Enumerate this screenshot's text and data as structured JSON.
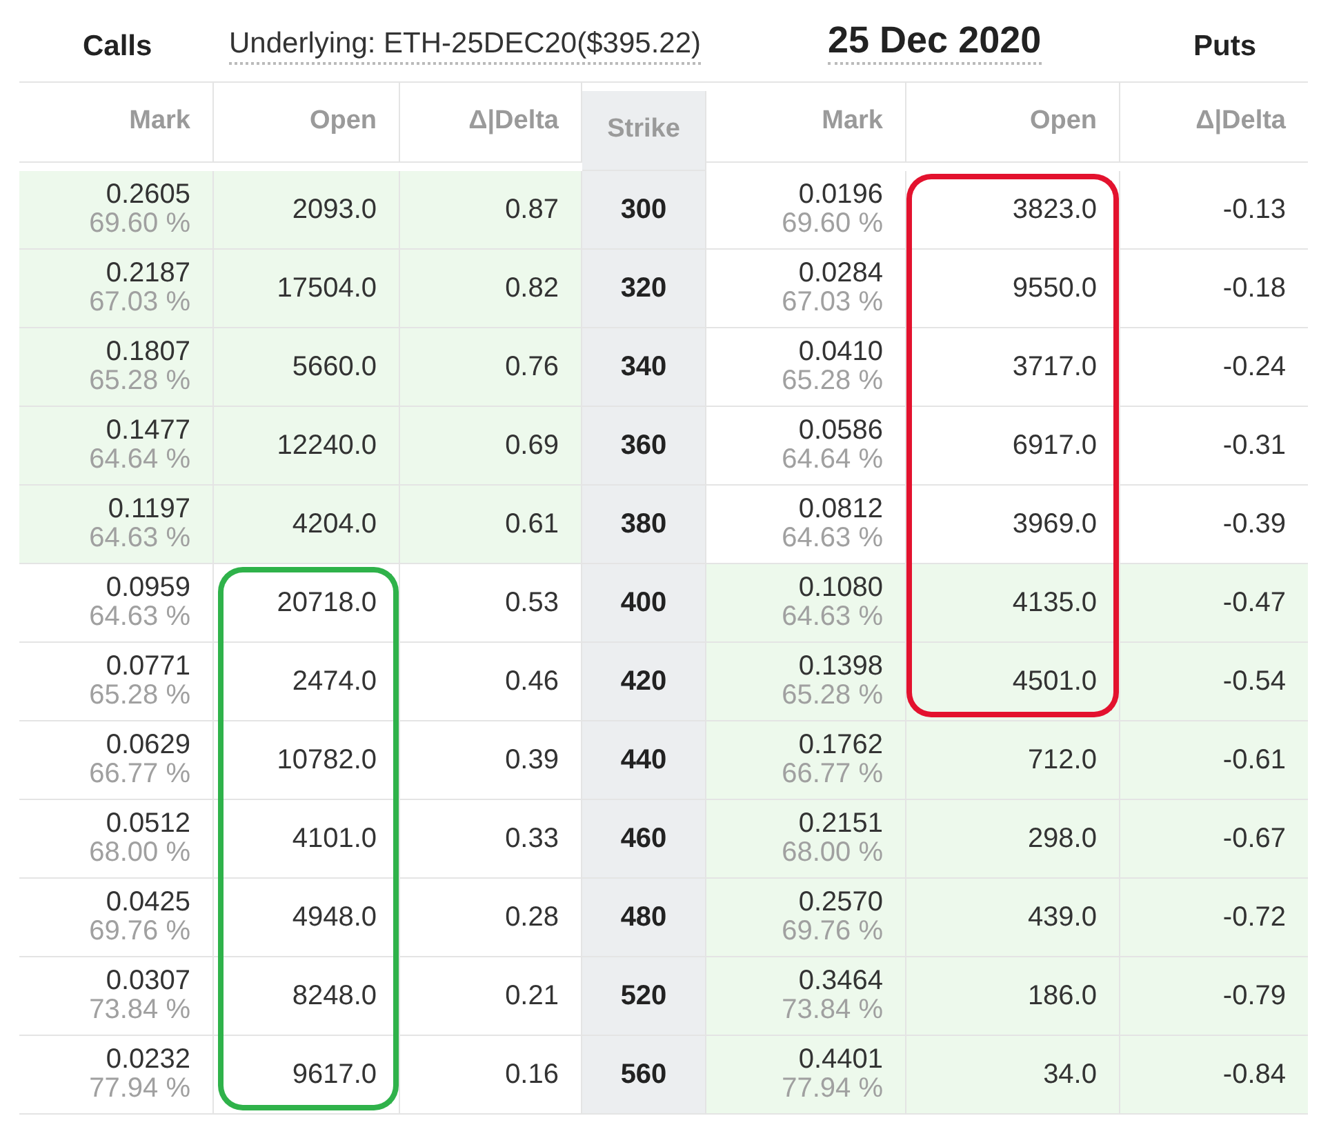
{
  "title": {
    "calls": "Calls",
    "underlying": "Underlying: ETH-25DEC20($395.22)",
    "expiry": "25 Dec 2020",
    "puts": "Puts"
  },
  "columns": [
    "Mark",
    "Open",
    "Δ|Delta",
    "Strike",
    "Mark",
    "Open",
    "Δ|Delta"
  ],
  "annotations": [
    {
      "kind": "put",
      "color": "#e3122e"
    },
    {
      "kind": "call",
      "color": "#2fb24a"
    }
  ],
  "rows": [
    {
      "strike": "300",
      "call": {
        "mark": "0.2605",
        "iv": "69.60 %",
        "open": "2093.0",
        "delta": "0.87",
        "itm": true,
        "circled": false
      },
      "put": {
        "mark": "0.0196",
        "iv": "69.60 %",
        "open": "3823.0",
        "delta": "-0.13",
        "itm": false,
        "circled": true
      }
    },
    {
      "strike": "320",
      "call": {
        "mark": "0.2187",
        "iv": "67.03 %",
        "open": "17504.0",
        "delta": "0.82",
        "itm": true,
        "circled": false
      },
      "put": {
        "mark": "0.0284",
        "iv": "67.03 %",
        "open": "9550.0",
        "delta": "-0.18",
        "itm": false,
        "circled": true
      }
    },
    {
      "strike": "340",
      "call": {
        "mark": "0.1807",
        "iv": "65.28 %",
        "open": "5660.0",
        "delta": "0.76",
        "itm": true,
        "circled": false
      },
      "put": {
        "mark": "0.0410",
        "iv": "65.28 %",
        "open": "3717.0",
        "delta": "-0.24",
        "itm": false,
        "circled": true
      }
    },
    {
      "strike": "360",
      "call": {
        "mark": "0.1477",
        "iv": "64.64 %",
        "open": "12240.0",
        "delta": "0.69",
        "itm": true,
        "circled": false
      },
      "put": {
        "mark": "0.0586",
        "iv": "64.64 %",
        "open": "6917.0",
        "delta": "-0.31",
        "itm": false,
        "circled": true
      }
    },
    {
      "strike": "380",
      "call": {
        "mark": "0.1197",
        "iv": "64.63 %",
        "open": "4204.0",
        "delta": "0.61",
        "itm": true,
        "circled": false
      },
      "put": {
        "mark": "0.0812",
        "iv": "64.63 %",
        "open": "3969.0",
        "delta": "-0.39",
        "itm": false,
        "circled": true
      }
    },
    {
      "strike": "400",
      "call": {
        "mark": "0.0959",
        "iv": "64.63 %",
        "open": "20718.0",
        "delta": "0.53",
        "itm": false,
        "circled": true
      },
      "put": {
        "mark": "0.1080",
        "iv": "64.63 %",
        "open": "4135.0",
        "delta": "-0.47",
        "itm": true,
        "circled": true
      }
    },
    {
      "strike": "420",
      "call": {
        "mark": "0.0771",
        "iv": "65.28 %",
        "open": "2474.0",
        "delta": "0.46",
        "itm": false,
        "circled": true
      },
      "put": {
        "mark": "0.1398",
        "iv": "65.28 %",
        "open": "4501.0",
        "delta": "-0.54",
        "itm": true,
        "circled": true
      }
    },
    {
      "strike": "440",
      "call": {
        "mark": "0.0629",
        "iv": "66.77 %",
        "open": "10782.0",
        "delta": "0.39",
        "itm": false,
        "circled": true
      },
      "put": {
        "mark": "0.1762",
        "iv": "66.77 %",
        "open": "712.0",
        "delta": "-0.61",
        "itm": true,
        "circled": false
      }
    },
    {
      "strike": "460",
      "call": {
        "mark": "0.0512",
        "iv": "68.00 %",
        "open": "4101.0",
        "delta": "0.33",
        "itm": false,
        "circled": true
      },
      "put": {
        "mark": "0.2151",
        "iv": "68.00 %",
        "open": "298.0",
        "delta": "-0.67",
        "itm": true,
        "circled": false
      }
    },
    {
      "strike": "480",
      "call": {
        "mark": "0.0425",
        "iv": "69.76 %",
        "open": "4948.0",
        "delta": "0.28",
        "itm": false,
        "circled": true
      },
      "put": {
        "mark": "0.2570",
        "iv": "69.76 %",
        "open": "439.0",
        "delta": "-0.72",
        "itm": true,
        "circled": false
      }
    },
    {
      "strike": "520",
      "call": {
        "mark": "0.0307",
        "iv": "73.84 %",
        "open": "8248.0",
        "delta": "0.21",
        "itm": false,
        "circled": true
      },
      "put": {
        "mark": "0.3464",
        "iv": "73.84 %",
        "open": "186.0",
        "delta": "-0.79",
        "itm": true,
        "circled": false
      }
    },
    {
      "strike": "560",
      "call": {
        "mark": "0.0232",
        "iv": "77.94 %",
        "open": "9617.0",
        "delta": "0.16",
        "itm": false,
        "circled": true
      },
      "put": {
        "mark": "0.4401",
        "iv": "77.94 %",
        "open": "34.0",
        "delta": "-0.84",
        "itm": true,
        "circled": false
      }
    }
  ]
}
